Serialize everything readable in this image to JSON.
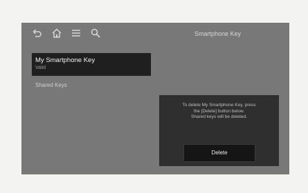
{
  "header": {
    "title": "Smartphone Key",
    "nav_icons": [
      "back-icon",
      "home-icon",
      "menu-icon",
      "search-icon"
    ]
  },
  "key_list": {
    "selected_item": {
      "name": "My Smartphone Key",
      "status": "Valid"
    },
    "shared_keys_label": "Shared Keys"
  },
  "info_panel": {
    "lines": [
      "To delete My Smartphone Key, press",
      "the [Delete] button below.",
      "Shared keys will be deleted."
    ],
    "delete_label": "Delete"
  },
  "colors": {
    "screen_background": "#787878",
    "selected_item_background": "#1f1f1f",
    "panel_background": "#2f2f2f",
    "button_background": "#151515"
  }
}
